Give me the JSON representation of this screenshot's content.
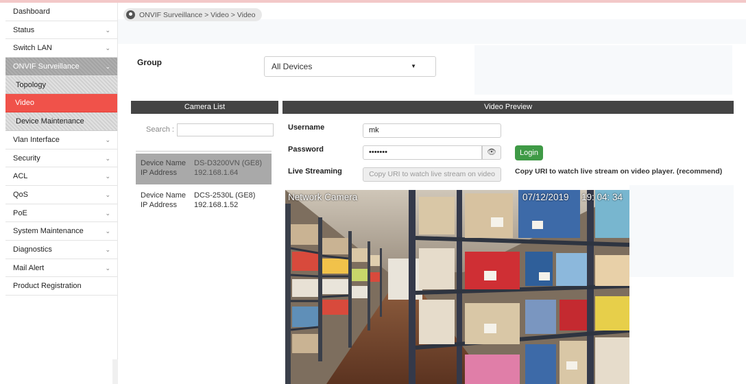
{
  "sidebar": {
    "items": [
      {
        "label": "Dashboard",
        "caret": ""
      },
      {
        "label": "Status",
        "caret": "⌄"
      },
      {
        "label": "Switch LAN",
        "caret": "⌄"
      },
      {
        "label": "ONVIF Surveillance",
        "caret": "⌄"
      },
      {
        "label": "Topology",
        "caret": ""
      },
      {
        "label": "Video",
        "caret": ""
      },
      {
        "label": "Device Maintenance",
        "caret": ""
      },
      {
        "label": "Vlan Interface",
        "caret": "⌄"
      },
      {
        "label": "Security",
        "caret": "⌄"
      },
      {
        "label": "ACL",
        "caret": "⌄"
      },
      {
        "label": "QoS",
        "caret": "⌄"
      },
      {
        "label": "PoE",
        "caret": "⌄"
      },
      {
        "label": "System Maintenance",
        "caret": "⌄"
      },
      {
        "label": "Diagnostics",
        "caret": "⌄"
      },
      {
        "label": "Mail Alert",
        "caret": "⌄"
      },
      {
        "label": "Product Registration",
        "caret": ""
      }
    ]
  },
  "breadcrumb": {
    "text": "ONVIF Surveillance > Video > Video"
  },
  "group": {
    "label": "Group",
    "selected": "All Devices",
    "arrow": "▼"
  },
  "camera_list": {
    "title": "Camera List",
    "search_label": "Search :",
    "search_value": "",
    "devices": [
      {
        "name_key": "Device Name",
        "name": "DS-D3200VN (GE8)",
        "ip_key": "IP Address",
        "ip": "192.168.1.64"
      },
      {
        "name_key": "Device Name",
        "name": "DCS-2530L (GE8)",
        "ip_key": "IP Address",
        "ip": "192.168.1.52"
      }
    ]
  },
  "preview": {
    "title": "Video Preview",
    "username_label": "Username",
    "username_value": "mk",
    "password_label": "Password",
    "password_value": "•••••••",
    "eye_icon": "eye-off-icon",
    "eye_glyph": "👁",
    "login_label": "Login",
    "streaming_label": "Live Streaming",
    "uri_button": "Copy URI to watch live stream on video",
    "copy_note": "Copy URI to watch live stream on video player. (recommend)",
    "osd_title": "Network Camera",
    "osd_date": "07/12/2019",
    "osd_time": "19: 04: 34"
  },
  "colors": {
    "active_nav": "#f0524a",
    "panel_header": "#444444",
    "login_button": "#3f9a46"
  }
}
